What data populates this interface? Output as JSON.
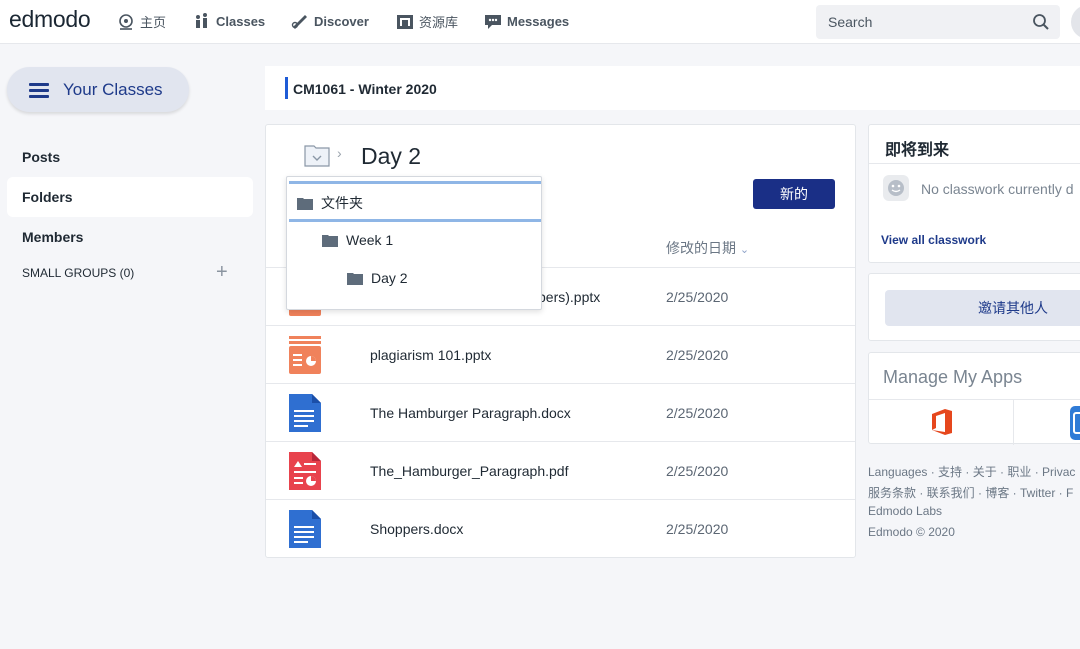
{
  "nav": {
    "logo": "edmodo",
    "items": [
      {
        "label": "主页",
        "icon": "home-icon"
      },
      {
        "label": "Classes",
        "icon": "classes-icon"
      },
      {
        "label": "Discover",
        "icon": "discover-icon"
      },
      {
        "label": "资源库",
        "icon": "library-icon"
      },
      {
        "label": "Messages",
        "icon": "messages-icon"
      }
    ],
    "search_placeholder": "Search"
  },
  "sidebar": {
    "your_classes": "Your Classes",
    "links": [
      "Posts",
      "Folders",
      "Members"
    ],
    "active": "Folders",
    "small_groups": "SMALL GROUPS (0)",
    "add_symbol": "+"
  },
  "class_title": "CM1061 - Winter 2020",
  "folder_view": {
    "chevron": "›",
    "current": "Day 2",
    "new_button": "新的",
    "modified_header": "修改的日期",
    "modified_caret": "⌄",
    "files": [
      {
        "name": "(Hamburger Paragraph for Shoppers).pptx",
        "visible_name": "pers).pptx",
        "date": "2/25/2020",
        "type": "pptx"
      },
      {
        "name": "plagiarism 101.pptx",
        "date": "2/25/2020",
        "type": "pptx"
      },
      {
        "name": "The Hamburger Paragraph.docx",
        "date": "2/25/2020",
        "type": "docx"
      },
      {
        "name": "The_Hamburger_Paragraph.pdf",
        "date": "2/25/2020",
        "type": "pdf"
      },
      {
        "name": "Shoppers.docx",
        "date": "2/25/2020",
        "type": "docx"
      }
    ],
    "dropdown": [
      "文件夹",
      "Week 1",
      "Day 2"
    ]
  },
  "right": {
    "upcoming_title": "即将到来",
    "upcoming_empty": "No classwork currently d",
    "view_all": "View all classwork",
    "invite": "邀请其他人",
    "manage_apps": "Manage My Apps",
    "footer": [
      "Languages · 支持 · 关于 · 职业 · Privac",
      "服务条款 · 联系我们 · 博客 · Twitter · F",
      "Edmodo Labs",
      "Edmodo © 2020"
    ]
  },
  "colors": {
    "primary": "#1a2f86",
    "accent_blue": "#1e5bd6",
    "pptx": "#f0825b",
    "pdf": "#e8434d",
    "docx": "#2f6fd1"
  }
}
